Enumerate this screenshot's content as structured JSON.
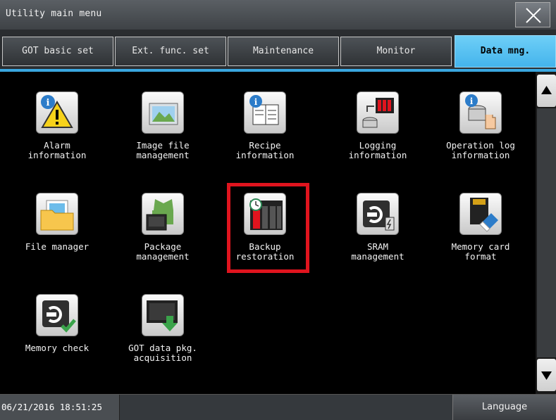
{
  "window": {
    "title": "Utility main menu",
    "close_icon": "close-icon"
  },
  "tabs": [
    {
      "label": "GOT basic set"
    },
    {
      "label": "Ext. func. set"
    },
    {
      "label": "Maintenance"
    },
    {
      "label": "Monitor"
    },
    {
      "label": "Data mng.",
      "active": true
    }
  ],
  "menu_items": [
    {
      "label": "Alarm\ninformation",
      "icon": "alarm-info-icon"
    },
    {
      "label": "Image file\nmanagement",
      "icon": "image-file-icon"
    },
    {
      "label": "Recipe\ninformation",
      "icon": "recipe-info-icon"
    },
    {
      "label": "Logging\ninformation",
      "icon": "logging-info-icon"
    },
    {
      "label": "Operation log\ninformation",
      "icon": "operation-log-icon"
    },
    {
      "label": "File manager",
      "icon": "folder-icon"
    },
    {
      "label": "Package\nmanagement",
      "icon": "package-icon"
    },
    {
      "label": "Backup\nrestoration",
      "icon": "backup-icon",
      "highlighted": true
    },
    {
      "label": "SRAM\nmanagement",
      "icon": "sram-icon"
    },
    {
      "label": "Memory card\nformat",
      "icon": "memory-card-icon"
    },
    {
      "label": "Memory check",
      "icon": "memory-check-icon"
    },
    {
      "label": "GOT data pkg.\nacquisition",
      "icon": "data-download-icon"
    }
  ],
  "status": {
    "datetime": "06/21/2016 18:51:25",
    "language_button": "Language"
  },
  "colors": {
    "active_tab": "#44b4ec",
    "highlight": "#e0141e",
    "background": "#000000"
  }
}
